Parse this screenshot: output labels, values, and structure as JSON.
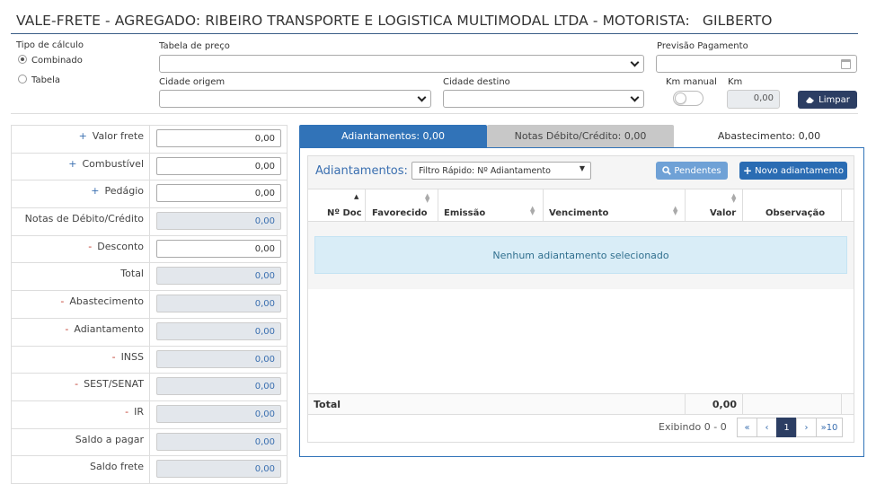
{
  "header": {
    "title": "VALE-FRETE - AGREGADO: RIBEIRO TRANSPORTE E LOGISTICA MULTIMODAL LTDA - MOTORISTA:",
    "driver": "GILBERTO"
  },
  "form": {
    "tipo_calculo_label": "Tipo de cálculo",
    "radio_combinado": "Combinado",
    "radio_tabela": "Tabela",
    "selected_radio": "Combinado",
    "tabela_preco_label": "Tabela de preço",
    "tabela_preco_value": "",
    "previsao_label": "Previsão Pagamento",
    "previsao_value": "",
    "cidade_origem_label": "Cidade origem",
    "cidade_origem_value": "",
    "cidade_destino_label": "Cidade destino",
    "cidade_destino_value": "",
    "km_manual_label": "Km manual",
    "km_manual_on": false,
    "km_label": "Km",
    "km_value": "0,00",
    "limpar_label": "Limpar"
  },
  "summary": [
    {
      "sign": "+",
      "label": "Valor frete",
      "value": "0,00",
      "readonly": false
    },
    {
      "sign": "+",
      "label": "Combustível",
      "value": "0,00",
      "readonly": false
    },
    {
      "sign": "+",
      "label": "Pedágio",
      "value": "0,00",
      "readonly": false
    },
    {
      "sign": "",
      "label": "Notas de Débito/Crédito",
      "value": "0,00",
      "readonly": true
    },
    {
      "sign": "-",
      "label": "Desconto",
      "value": "0,00",
      "readonly": false
    },
    {
      "sign": "",
      "label": "Total",
      "value": "0,00",
      "readonly": true
    },
    {
      "sign": "-",
      "label": "Abastecimento",
      "value": "0,00",
      "readonly": true
    },
    {
      "sign": "-",
      "label": "Adiantamento",
      "value": "0,00",
      "readonly": true
    },
    {
      "sign": "-",
      "label": "INSS",
      "value": "0,00",
      "readonly": true
    },
    {
      "sign": "-",
      "label": "SEST/SENAT",
      "value": "0,00",
      "readonly": true
    },
    {
      "sign": "-",
      "label": "IR",
      "value": "0,00",
      "readonly": true
    },
    {
      "sign": "",
      "label": "Saldo a pagar",
      "value": "0,00",
      "readonly": true
    },
    {
      "sign": "",
      "label": "Saldo frete",
      "value": "0,00",
      "readonly": true
    }
  ],
  "tabs": [
    {
      "label": "Adiantamentos: 0,00",
      "active": true
    },
    {
      "label": "Notas Débito/Crédito: 0,00",
      "active": false
    },
    {
      "label": "Abastecimento: 0,00",
      "active": false
    }
  ],
  "adiantamentos": {
    "section_label": "Adiantamentos:",
    "filter_value": "Filtro Rápido: Nº Adiantamento",
    "pendentes_label": "Pendentes",
    "novo_label": "Novo adiantamento",
    "columns": [
      "Nº Doc",
      "Favorecido",
      "Emissão",
      "Vencimento",
      "Valor",
      "Observação"
    ],
    "empty_message": "Nenhum adiantamento selecionado",
    "total_label": "Total",
    "total_value": "0,00",
    "exibindo": "Exibindo 0 - 0",
    "pager": {
      "first": "«",
      "prev": "‹",
      "current": "1",
      "next": "›",
      "last10": "»10"
    }
  },
  "colors": {
    "primary": "#3173b8",
    "dark_button": "#2c3e63",
    "info_bg": "#d9edf7",
    "info_text": "#31708f"
  }
}
